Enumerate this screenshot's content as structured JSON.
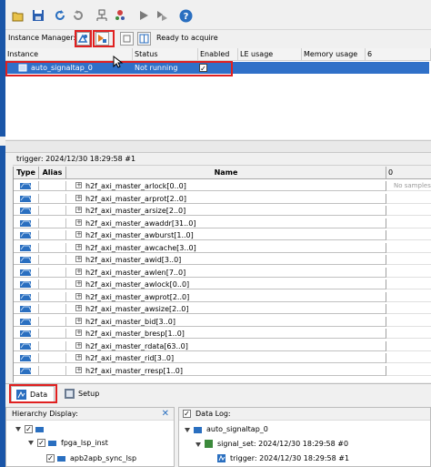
{
  "colors": {
    "accent": "#2f70c8",
    "highlight": "#e02020",
    "strip": "#1a56a8"
  },
  "toolbar": {
    "icons": [
      "open-icon",
      "save-icon",
      "undo-icon",
      "redo-icon",
      "attach-icon",
      "hierarchy-icon",
      "run-icon",
      "autorun-icon",
      "help-icon"
    ]
  },
  "instance_manager": {
    "label": "Instance Manager:",
    "status": "Ready to acquire"
  },
  "instance_table": {
    "columns": [
      "Instance",
      "Status",
      "Enabled",
      "LE usage",
      "Memory usage",
      "6"
    ],
    "row": {
      "instance": "auto_signaltap_0",
      "status": "Not running",
      "enabled": "✓"
    }
  },
  "trigger": {
    "header": "trigger: 2024/12/30 18:29:58  #1"
  },
  "signal_table": {
    "columns": {
      "type": "Type",
      "alias": "Alias",
      "name": "Name",
      "wave": "0"
    },
    "no_samples": "No samples",
    "rows": [
      "h2f_axi_master_arlock[0..0]",
      "h2f_axi_master_arprot[2..0]",
      "h2f_axi_master_arsize[2..0]",
      "h2f_axi_master_awaddr[31..0]",
      "h2f_axi_master_awburst[1..0]",
      "h2f_axi_master_awcache[3..0]",
      "h2f_axi_master_awid[3..0]",
      "h2f_axi_master_awlen[7..0]",
      "h2f_axi_master_awlock[0..0]",
      "h2f_axi_master_awprot[2..0]",
      "h2f_axi_master_awsize[2..0]",
      "h2f_axi_master_bid[3..0]",
      "h2f_axi_master_bresp[1..0]",
      "h2f_axi_master_rdata[63..0]",
      "h2f_axi_master_rid[3..0]",
      "h2f_axi_master_rresp[1..0]"
    ]
  },
  "tabs": {
    "data": "Data",
    "setup": "Setup"
  },
  "hierarchy": {
    "title": "Hierarchy Display:",
    "close": "✕",
    "check": "✓",
    "items": [
      "fpga_lsp_inst",
      "apb2apb_sync_lsp"
    ]
  },
  "data_log": {
    "title": "Data Log:",
    "check": "✓",
    "items": [
      "auto_signaltap_0",
      "signal_set: 2024/12/30 18:29:58  #0",
      "trigger: 2024/12/30 18:29:58  #1"
    ]
  }
}
